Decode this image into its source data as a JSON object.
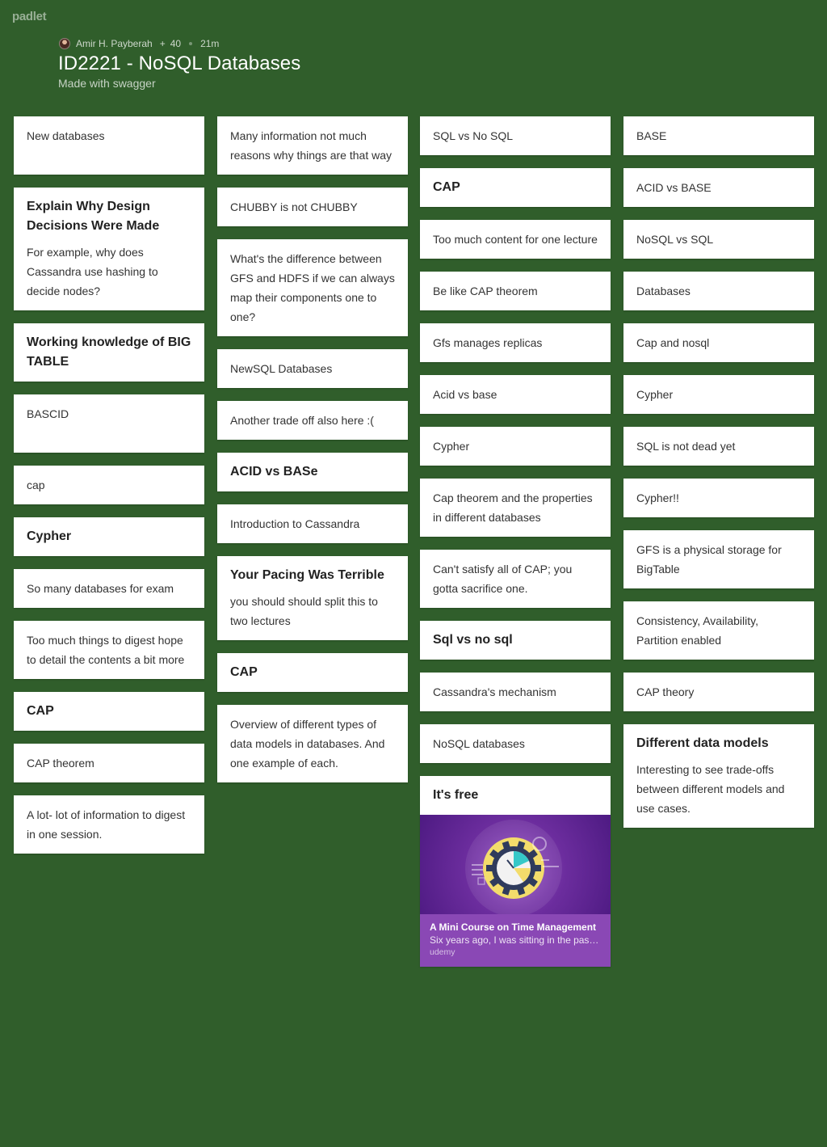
{
  "app": {
    "logo": "padlet"
  },
  "header": {
    "author": "Amir H. Payberah",
    "likes": "40",
    "time": "21m",
    "title": "ID2221 - NoSQL Databases",
    "subtitle": "Made with swagger"
  },
  "columns": [
    {
      "cards": [
        {
          "body": "New databases"
        },
        {
          "head": "Explain Why Design Decisions Were Made",
          "body": "For example, why does Cassandra use hashing to decide nodes?"
        },
        {
          "head": "Working knowledge of BIG TABLE"
        },
        {
          "body": "BASCID"
        },
        {
          "body": "cap"
        },
        {
          "head": "Cypher"
        },
        {
          "body": "So many databases for exam"
        },
        {
          "body": "Too much things to digest hope to detail the contents a bit more"
        },
        {
          "head": "CAP"
        },
        {
          "body": "CAP theorem"
        },
        {
          "body": "A lot- lot of information to digest in one session."
        }
      ]
    },
    {
      "cards": [
        {
          "body": "Many information not much reasons why things are that way"
        },
        {
          "body": "CHUBBY is not CHUBBY"
        },
        {
          "body": "What's the difference between GFS and HDFS if we can always map their components one to one?"
        },
        {
          "body": "NewSQL Databases"
        },
        {
          "body": "Another trade off also here :("
        },
        {
          "head": "ACID vs BASe"
        },
        {
          "body": "Introduction to Cassandra"
        },
        {
          "head": "Your Pacing Was Terrible",
          "body": " you should should split this to two lectures"
        },
        {
          "head": "CAP"
        },
        {
          "body": "Overview of different types of data models in databases. And one example of each."
        }
      ]
    },
    {
      "cards": [
        {
          "body": "SQL vs No SQL"
        },
        {
          "head": "CAP"
        },
        {
          "body": "Too much content for one lecture"
        },
        {
          "body": "Be like CAP theorem"
        },
        {
          "body": "Gfs manages replicas"
        },
        {
          "body": "Acid vs base"
        },
        {
          "body": "Cypher"
        },
        {
          "body": "Cap theorem and the properties in different databases"
        },
        {
          "body": "Can't satisfy all of CAP; you gotta sacrifice one."
        },
        {
          "head": "Sql vs no sql"
        },
        {
          "body": "Cassandra's mechanism"
        },
        {
          "body": "NoSQL databases"
        },
        {
          "head": "It's free",
          "attachment": {
            "title": "A Mini Course on Time Management",
            "description": "Six years ago, I was sitting in the pas…",
            "source": "udemy"
          }
        }
      ]
    },
    {
      "cards": [
        {
          "body": "BASE"
        },
        {
          "body": "ACID vs BASE"
        },
        {
          "body": "NoSQL vs SQL"
        },
        {
          "body": "Databases"
        },
        {
          "body": "Cap and nosql"
        },
        {
          "body": "Cypher"
        },
        {
          "body": "SQL is not dead yet"
        },
        {
          "body": "Cypher!!"
        },
        {
          "body": "GFS is a physical storage for BigTable"
        },
        {
          "body": " Consistency, Availability, Partition enabled"
        },
        {
          "body": "CAP theory"
        },
        {
          "head": "Different data models",
          "body": "Interesting to see trade-offs between different models and use cases."
        }
      ]
    }
  ],
  "colors": {
    "background": "#305e2b",
    "card": "#ffffff",
    "attachment_preview": "#8a48b5"
  }
}
